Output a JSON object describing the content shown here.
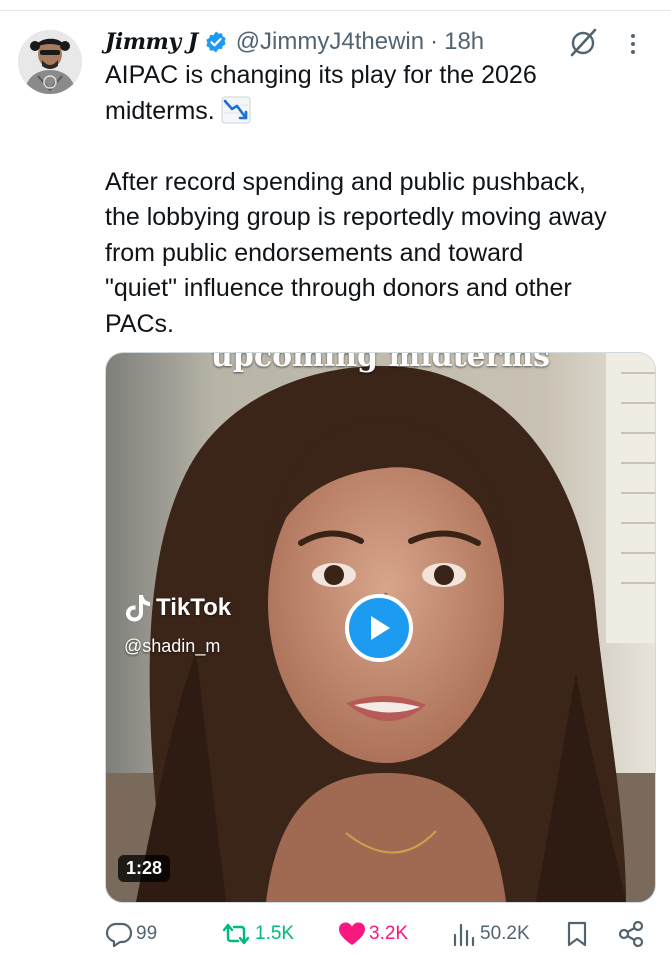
{
  "tweet": {
    "display_name": "Jimmy J",
    "handle": "@JimmyJ4thewin",
    "separator": "·",
    "time": "18h",
    "text_line1": "AIPAC is changing its play for the 2026",
    "text_line2": "midterms.",
    "emoji": "chart-decreasing-emoji",
    "text_para2_l1": "After record spending and public pushback,",
    "text_para2_l2": "the lobbying group is reportedly moving away",
    "text_para2_l3": "from public endorsements and toward",
    "text_para2_l4": "\"quiet\" influence through donors and other",
    "text_para2_l5": "PACs."
  },
  "media": {
    "caption_top": "upcoming midterms",
    "watermark_brand": "TikTok",
    "watermark_user": "@shadin_m",
    "duration": "1:28"
  },
  "actions": {
    "replies": "99",
    "reposts": "1.5K",
    "likes": "3.2K",
    "views": "50.2K"
  },
  "colors": {
    "verified": "#1d9bf0",
    "repost_active": "#00ba7c",
    "like_active": "#f91880",
    "secondary_text": "#536471",
    "play_button": "#1d9bf0"
  }
}
